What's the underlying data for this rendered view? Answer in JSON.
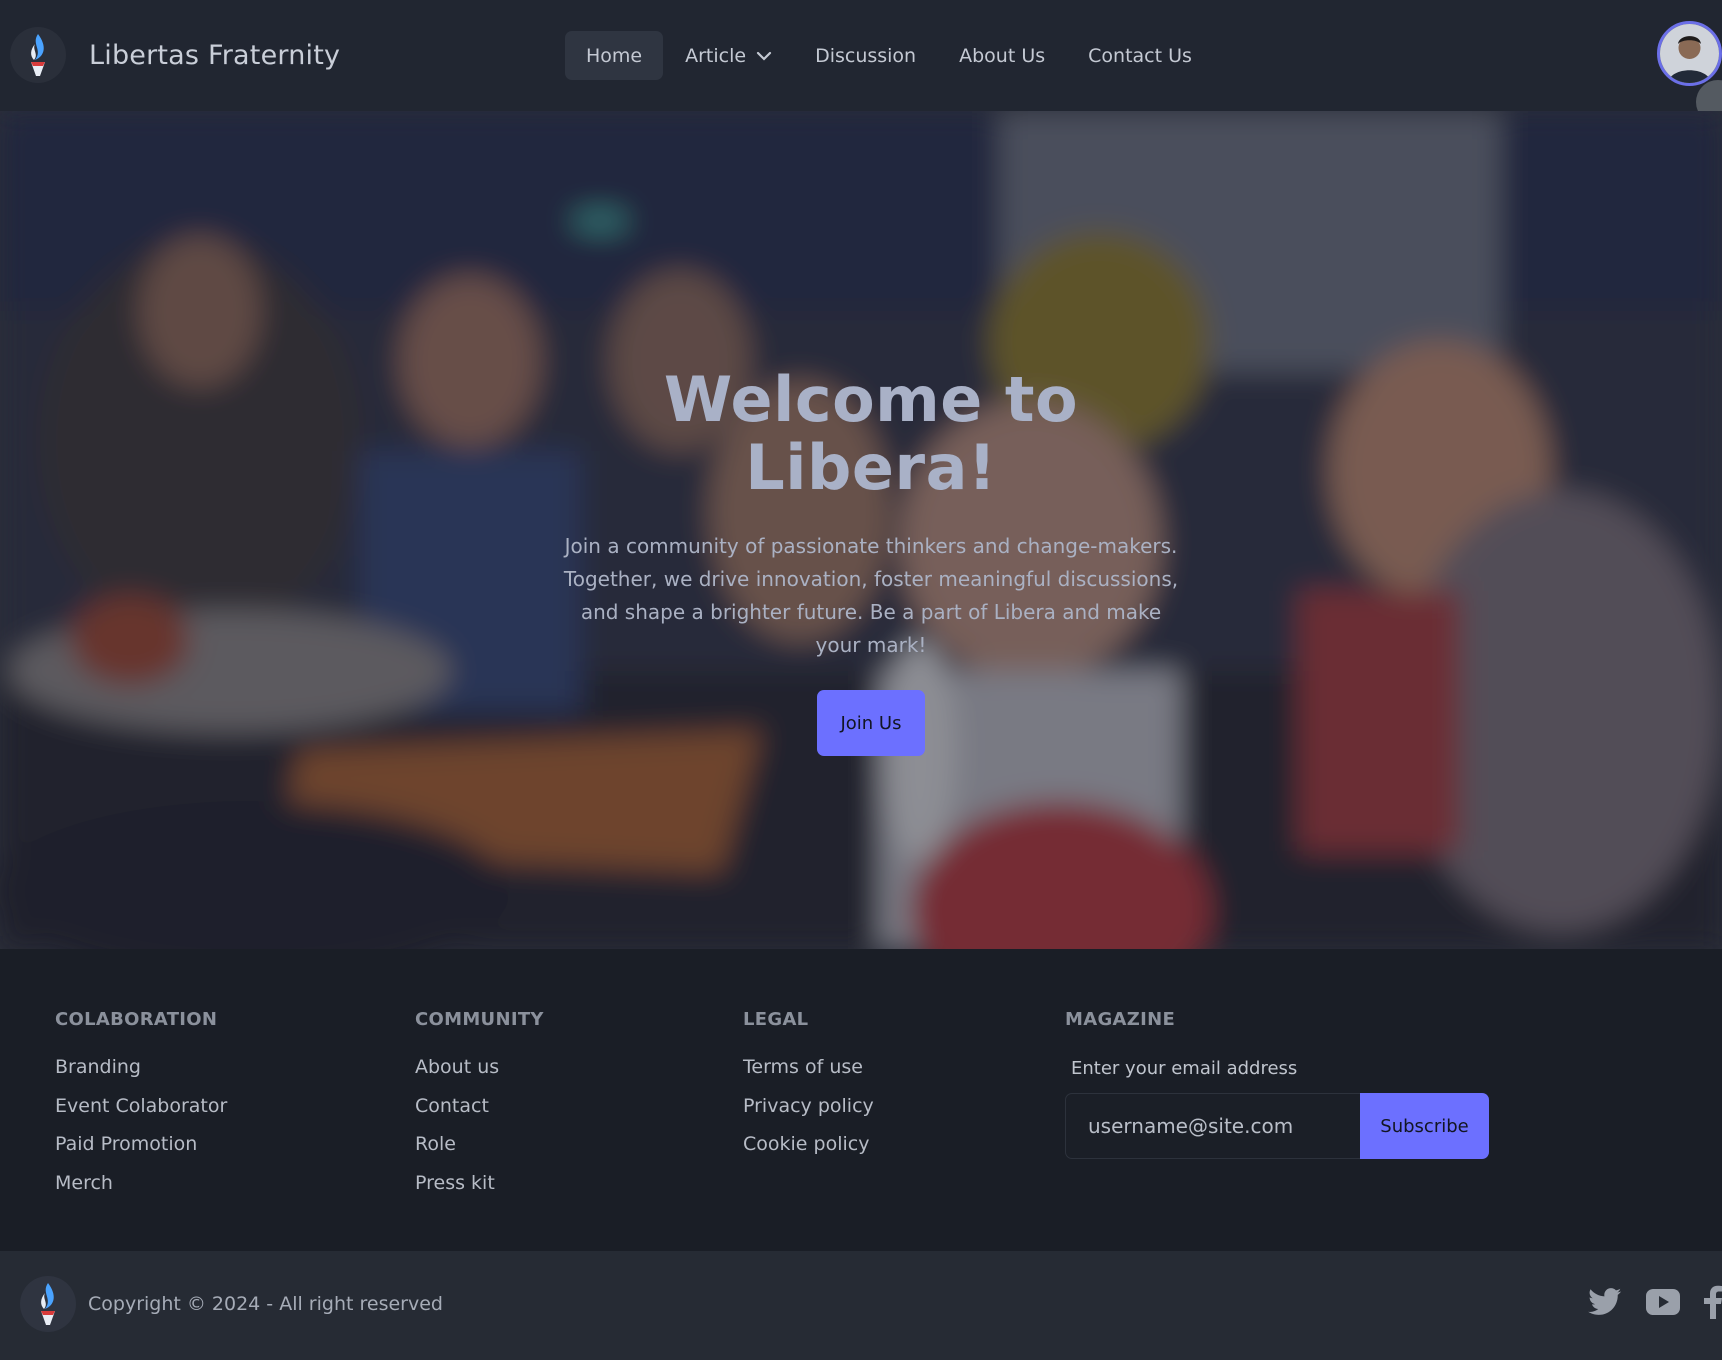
{
  "brand": {
    "name": "Libertas Fraternity",
    "logo_icon": "flame-torch-icon"
  },
  "nav": {
    "items": [
      {
        "label": "Home",
        "active": true
      },
      {
        "label": "Article",
        "has_dropdown": true
      },
      {
        "label": "Discussion"
      },
      {
        "label": "About Us"
      },
      {
        "label": "Contact Us"
      }
    ],
    "profile_icon": "avatar-icon"
  },
  "hero": {
    "title": "Welcome to Libera!",
    "description": "Join a community of passionate thinkers and change-makers. Together, we drive innovation, foster meaningful discussions, and shape a brighter future. Be a part of Libera and make your mark!",
    "button_label": "Join Us"
  },
  "footer": {
    "columns": [
      {
        "heading": "COLABORATION",
        "links": [
          "Branding",
          "Event Colaborator",
          "Paid Promotion",
          "Merch"
        ]
      },
      {
        "heading": "COMMUNITY",
        "links": [
          "About us",
          "Contact",
          "Role",
          "Press kit"
        ]
      },
      {
        "heading": "LEGAL",
        "links": [
          "Terms of use",
          "Privacy policy",
          "Cookie policy"
        ]
      }
    ],
    "magazine": {
      "heading": "MAGAZINE",
      "label": "Enter your email address",
      "placeholder": "username@site.com",
      "button_label": "Subscribe"
    }
  },
  "bottom": {
    "copyright": "Copyright © 2024 - All right reserved",
    "socials": [
      "twitter-icon",
      "youtube-icon",
      "facebook-icon"
    ]
  },
  "colors": {
    "accent": "#6c70ff",
    "navbar_bg": "#212631",
    "footer_bg": "#1a1e26",
    "bottom_bar_bg": "#262b34"
  }
}
